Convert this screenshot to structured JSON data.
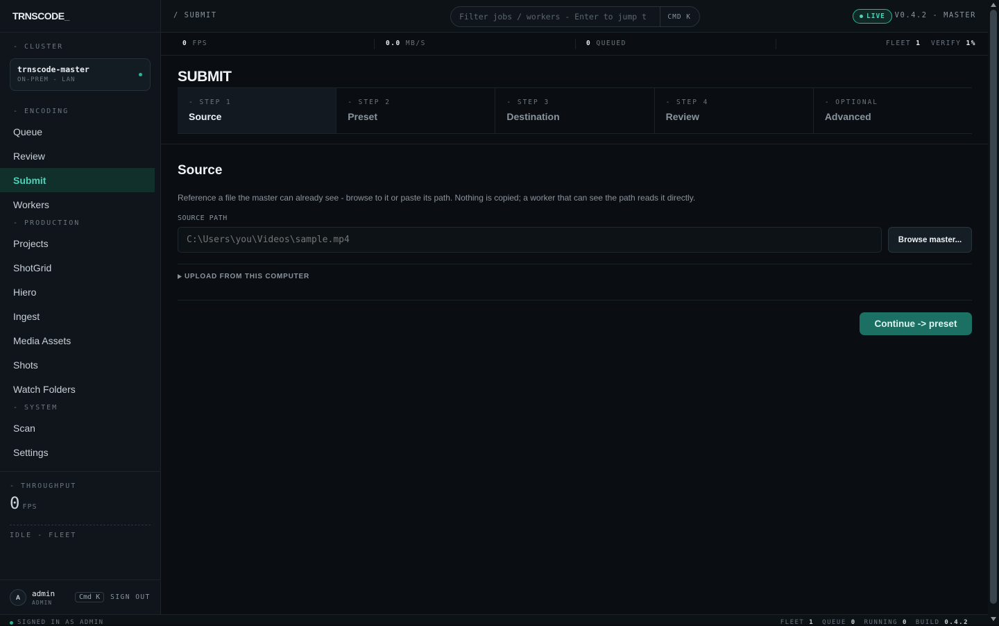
{
  "app": {
    "brand": "TRNSCODE",
    "brand_cursor": "_"
  },
  "sidebar": {
    "cluster_label": "- CLUSTER",
    "cluster": {
      "name": "trnscode-master",
      "sub": "ON-PREM - LAN"
    },
    "sections": {
      "encoding": "- ENCODING",
      "production": "- PRODUCTION",
      "system": "- SYSTEM"
    },
    "encoding_items": [
      "Queue",
      "Review",
      "Submit",
      "Workers"
    ],
    "production_items": [
      "Projects",
      "ShotGrid",
      "Hiero",
      "Ingest",
      "Media Assets",
      "Shots",
      "Watch Folders"
    ],
    "system_items": [
      "Scan",
      "Settings"
    ],
    "throughput": {
      "label": "- THROUGHPUT",
      "value": "0",
      "unit": "FPS"
    },
    "fleet_status": "IDLE - FLEET",
    "user": {
      "initial": "A",
      "name": "admin",
      "role": "ADMIN",
      "shortcut": "Cmd K",
      "signout": "SIGN OUT"
    }
  },
  "topbar": {
    "breadcrumb": "/ SUBMIT",
    "search_placeholder": "Filter jobs / workers - Enter to jump t",
    "search_shortcut": "CMD K",
    "live": "LIVE",
    "version": "V0.4.2 - MASTER"
  },
  "stats": {
    "fps_value": "0",
    "fps_unit": "FPS",
    "mbs_value": "0.0",
    "mbs_unit": "MB/S",
    "queued_value": "0",
    "queued_unit": "QUEUED",
    "fleet_label": "FLEET",
    "fleet_value": "1",
    "verify_label": "VERIFY",
    "verify_value": "1%"
  },
  "main": {
    "title": "SUBMIT",
    "steps": [
      {
        "label": "- STEP 1",
        "name": "Source"
      },
      {
        "label": "- STEP 2",
        "name": "Preset"
      },
      {
        "label": "- STEP 3",
        "name": "Destination"
      },
      {
        "label": "- STEP 4",
        "name": "Review"
      },
      {
        "label": "- OPTIONAL",
        "name": "Advanced"
      }
    ],
    "section_title": "Source",
    "description": "Reference a file the master can already see - browse to it or paste its path. Nothing is copied; a worker that can see the path reads it directly.",
    "field_label": "SOURCE PATH",
    "path_placeholder": "C:\\Users\\you\\Videos\\sample.mp4",
    "browse_label": "Browse master...",
    "upload_label": "UPLOAD FROM THIS COMPUTER",
    "continue_label": "Continue -> preset"
  },
  "statusbar": {
    "signed_in": "SIGNED IN AS ADMIN",
    "fleet_label": "FLEET",
    "fleet_value": "1",
    "queue_label": "QUEUE",
    "queue_value": "0",
    "running_label": "RUNNING",
    "running_value": "0",
    "build_label": "BUILD",
    "build_value": "0.4.2"
  },
  "colors": {
    "accent": "#4fd1b8",
    "primary_button": "#1c6f63",
    "background": "#0a0e12",
    "sidebar": "#0f151b"
  }
}
